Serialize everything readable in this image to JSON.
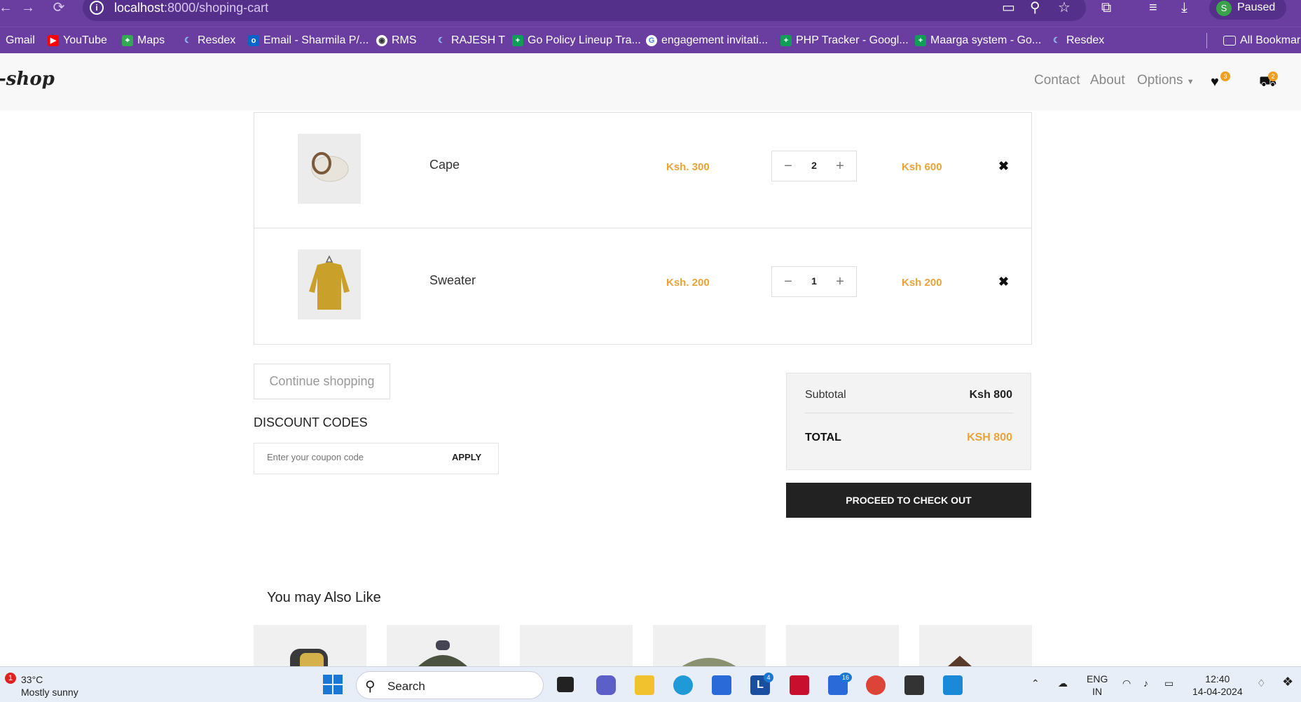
{
  "browser": {
    "url_host": "localhost",
    "url_path": ":8000/shoping-cart",
    "profile_initial": "S",
    "profile_status": "Paused",
    "bookmarks": [
      {
        "label": "Gmail",
        "icon_color": "#ea4335"
      },
      {
        "label": "YouTube",
        "icon_color": "#ff0000"
      },
      {
        "label": "Maps",
        "icon_color": "#34a853"
      },
      {
        "label": "Resdex",
        "icon_color": "#4a90e2"
      },
      {
        "label": "Email - Sharmila P/...",
        "icon_color": "#0a64c8"
      },
      {
        "label": "RMS",
        "icon_color": "#ffffff"
      },
      {
        "label": "RAJESH T",
        "icon_color": "#4a90e2"
      },
      {
        "label": "Go Policy Lineup Tra...",
        "icon_color": "#0f9d58"
      },
      {
        "label": "engagement invitati...",
        "icon_color": "#ffffff"
      },
      {
        "label": "PHP Tracker - Googl...",
        "icon_color": "#0f9d58"
      },
      {
        "label": "Maarga system - Go...",
        "icon_color": "#0f9d58"
      },
      {
        "label": "Resdex",
        "icon_color": "#4a90e2"
      }
    ],
    "all_bookmarks": "All Bookmarks"
  },
  "site": {
    "logo": "-shop",
    "menu": [
      "Contact",
      "About",
      "Options"
    ],
    "wishlist_count": "3",
    "cart_count": "2"
  },
  "cart": {
    "items": [
      {
        "name": "Cape",
        "price": "Ksh. 300",
        "qty": "2",
        "total": "Ksh 600",
        "remove": "✖"
      },
      {
        "name": "Sweater",
        "price": "Ksh. 200",
        "qty": "1",
        "total": "Ksh 200",
        "remove": "✖"
      }
    ],
    "continue_label": "Continue shopping",
    "discount_title": "DISCOUNT CODES",
    "coupon_placeholder": "Enter your coupon code",
    "apply_label": "APPLY",
    "subtotal_label": "Subtotal",
    "subtotal_value": "Ksh 800",
    "total_label": "TOTAL",
    "total_value": "KSH 800",
    "checkout_label": "PROCEED TO CHECK OUT",
    "accent_color": "#e8a33b"
  },
  "recommend": {
    "title": "You may Also Like"
  },
  "taskbar": {
    "notif_count": "1",
    "temperature": "33°C",
    "weather": "Mostly sunny",
    "search_label": "Search",
    "lang_top": "ENG",
    "lang_bottom": "IN",
    "time": "12:40",
    "date": "14-04-2024",
    "badge_l": "4",
    "badge_phone": "16"
  }
}
